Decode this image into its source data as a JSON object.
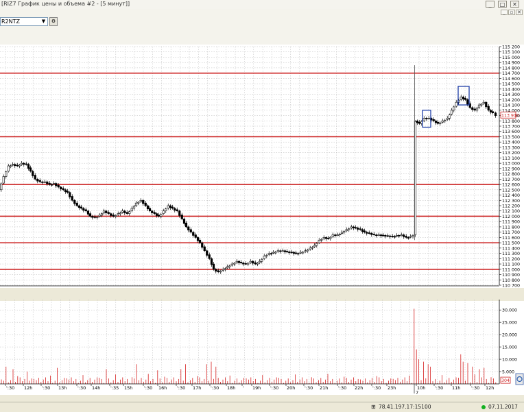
{
  "window": {
    "title": "[RIZ7 График цены и объема #2 - [5 минут]]",
    "btn_min": "_",
    "btn_max": "□",
    "btn_close": "✕",
    "inner_min": "_",
    "inner_restore": "▫",
    "inner_close": "✕"
  },
  "toolbar": {
    "instrument": "R2NTZ",
    "dropdown_icon": "chevron-down-icon",
    "action_icon": "gear-icon"
  },
  "colors": {
    "level_line": "#cc2222",
    "candle": "#000000",
    "volume": "#d62020",
    "marker": "#1f3fa8",
    "grid": "#b9b9b9",
    "price_label": "#cc2222"
  },
  "chart_data": {
    "type": "candlestick",
    "price_axis": {
      "ylim": [
        110700,
        115200
      ],
      "tick_step": 100,
      "current_price_label": "113 910"
    },
    "horizontal_levels": [
      114700,
      113500,
      112600,
      112000,
      111500,
      111000
    ],
    "price_path": [
      [
        0,
        112500
      ],
      [
        7,
        112750
      ],
      [
        14,
        112950
      ],
      [
        20,
        112980
      ],
      [
        27,
        112950
      ],
      [
        33,
        113000
      ],
      [
        40,
        112980
      ],
      [
        46,
        112850
      ],
      [
        53,
        112700
      ],
      [
        60,
        112650
      ],
      [
        67,
        112650
      ],
      [
        74,
        112600
      ],
      [
        80,
        112620
      ],
      [
        87,
        112550
      ],
      [
        94,
        112500
      ],
      [
        100,
        112450
      ],
      [
        107,
        112300
      ],
      [
        114,
        112200
      ],
      [
        120,
        112150
      ],
      [
        127,
        112100
      ],
      [
        133,
        112000
      ],
      [
        140,
        111980
      ],
      [
        147,
        112020
      ],
      [
        153,
        112100
      ],
      [
        160,
        112050
      ],
      [
        167,
        112000
      ],
      [
        174,
        112050
      ],
      [
        180,
        112100
      ],
      [
        187,
        112050
      ],
      [
        194,
        112150
      ],
      [
        200,
        112250
      ],
      [
        207,
        112300
      ],
      [
        214,
        112200
      ],
      [
        220,
        112100
      ],
      [
        227,
        112050
      ],
      [
        233,
        112000
      ],
      [
        240,
        112100
      ],
      [
        247,
        112200
      ],
      [
        253,
        112150
      ],
      [
        260,
        112100
      ],
      [
        267,
        111950
      ],
      [
        273,
        111800
      ],
      [
        280,
        111700
      ],
      [
        287,
        111600
      ],
      [
        293,
        111500
      ],
      [
        300,
        111350
      ],
      [
        307,
        111200
      ],
      [
        313,
        111000
      ],
      [
        320,
        110950
      ],
      [
        327,
        111000
      ],
      [
        333,
        111050
      ],
      [
        340,
        111100
      ],
      [
        347,
        111150
      ],
      [
        353,
        111120
      ],
      [
        360,
        111100
      ],
      [
        367,
        111150
      ],
      [
        374,
        111100
      ],
      [
        380,
        111150
      ],
      [
        387,
        111250
      ],
      [
        394,
        111300
      ],
      [
        400,
        111320
      ],
      [
        407,
        111350
      ],
      [
        414,
        111350
      ],
      [
        420,
        111330
      ],
      [
        427,
        111320
      ],
      [
        433,
        111300
      ],
      [
        440,
        111320
      ],
      [
        447,
        111350
      ],
      [
        454,
        111400
      ],
      [
        460,
        111450
      ],
      [
        467,
        111550
      ],
      [
        474,
        111600
      ],
      [
        480,
        111580
      ],
      [
        487,
        111650
      ],
      [
        494,
        111650
      ],
      [
        500,
        111700
      ],
      [
        507,
        111750
      ],
      [
        514,
        111800
      ],
      [
        520,
        111780
      ],
      [
        527,
        111750
      ],
      [
        533,
        111700
      ],
      [
        540,
        111680
      ],
      [
        547,
        111650
      ],
      [
        554,
        111650
      ],
      [
        560,
        111640
      ],
      [
        567,
        111630
      ],
      [
        574,
        111620
      ],
      [
        580,
        111640
      ],
      [
        587,
        111650
      ],
      [
        594,
        111600
      ],
      [
        600,
        111620
      ],
      [
        604,
        111650
      ],
      [
        607,
        113800
      ],
      [
        613,
        113750
      ],
      [
        620,
        113850
      ],
      [
        627,
        113850
      ],
      [
        634,
        113800
      ],
      [
        640,
        113750
      ],
      [
        647,
        113800
      ],
      [
        654,
        113850
      ],
      [
        660,
        114000
      ],
      [
        667,
        114150
      ],
      [
        674,
        114250
      ],
      [
        680,
        114200
      ],
      [
        687,
        114050
      ],
      [
        694,
        114000
      ],
      [
        700,
        114100
      ],
      [
        707,
        114150
      ],
      [
        714,
        114000
      ],
      [
        720,
        113950
      ],
      [
        725,
        113910
      ]
    ],
    "volume_axis": {
      "ylim": [
        0,
        32000
      ],
      "tick_labels": [
        "30.000",
        "25.000",
        "20.000",
        "15.000",
        "10.000",
        "5.000"
      ],
      "tick_values": [
        30000,
        25000,
        20000,
        15000,
        10000,
        5000
      ],
      "current_volume_label": "304"
    },
    "volume_spikes": [
      [
        605,
        30500
      ],
      [
        608,
        14000
      ],
      [
        612,
        10000
      ],
      [
        618,
        9000
      ],
      [
        624,
        8000
      ],
      [
        628,
        7000
      ],
      [
        672,
        12000
      ],
      [
        676,
        9000
      ],
      [
        683,
        8500
      ],
      [
        690,
        7000
      ],
      [
        700,
        6000
      ],
      [
        706,
        6500
      ],
      [
        304,
        8000
      ],
      [
        310,
        9000
      ],
      [
        316,
        7000
      ],
      [
        201,
        8000
      ],
      [
        20,
        6000
      ],
      [
        40,
        5000
      ],
      [
        265,
        6000
      ],
      [
        272,
        8000
      ],
      [
        10,
        7000
      ],
      [
        86,
        6500
      ],
      [
        158,
        6000
      ],
      [
        230,
        5500
      ]
    ],
    "volume_baseline_max": 4500,
    "x_axis": {
      "labels": [
        "':30",
        "12h",
        "':30",
        "13h",
        "':30",
        "14h",
        "':35",
        "15h",
        "':30",
        "16h",
        "':30",
        "17h",
        "':30",
        "18h",
        "'",
        "19h",
        "':30",
        "20h",
        "':30",
        "21h",
        "':30",
        "22h",
        "':30",
        "23h",
        "10h",
        "':30",
        "11h",
        "':30",
        "12h"
      ],
      "label_x": [
        8,
        34,
        60,
        84,
        112,
        133,
        160,
        180,
        209,
        230,
        257,
        280,
        306,
        330,
        353,
        367,
        393,
        417,
        443,
        465,
        492,
        516,
        542,
        564,
        607,
        633,
        658,
        686,
        707
      ],
      "date_marker": "7"
    },
    "markers": [
      {
        "x1": 616,
        "x2": 628,
        "y1": 114000,
        "y2": 113680
      },
      {
        "x1": 668,
        "x2": 684,
        "y1": 114450,
        "y2": 114100
      }
    ],
    "title": "",
    "xlabel": "",
    "ylabel": ""
  },
  "status": {
    "connection": "78.41.197.17:15100",
    "date": "07.11.2017",
    "network_icon": "network-icon",
    "online_icon": "online-status-icon"
  }
}
